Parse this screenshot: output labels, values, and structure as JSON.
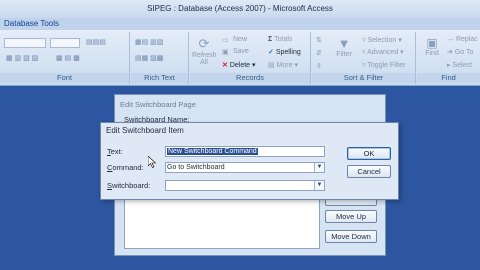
{
  "window": {
    "title": "SIPEG : Database (Access 2007) - Microsoft Access"
  },
  "tabs": {
    "database_tools": "Database Tools"
  },
  "ribbon": {
    "font_group": "Font",
    "rich_text_group": "Rich Text",
    "records_group": {
      "label": "Records",
      "refresh_all": "Refresh All",
      "new": "New",
      "save": "Save",
      "delete": "Delete",
      "totals": "Totals",
      "spelling": "Spelling",
      "more": "More"
    },
    "sort_filter_group": {
      "label": "Sort & Filter",
      "filter": "Filter",
      "selection": "Selection",
      "advanced": "Advanced",
      "toggle_filter": "Toggle Filter"
    },
    "find_group": {
      "label": "Find",
      "find": "Find",
      "replace": "Replac",
      "go_to": "Go To",
      "select": "Select"
    }
  },
  "switchboard_page": {
    "title": "Edit Switchboard Page",
    "name_label": "Switchboard Name:",
    "buttons": {
      "move_up": "Move Up",
      "move_down": "Move Down"
    }
  },
  "switchboard_item": {
    "title": "Edit Switchboard Item",
    "text_label": "Text:",
    "text_value": "New Switchboard Command",
    "command_label": "Command:",
    "command_value": "Go to Switchboard",
    "switchboard_label": "Switchboard:",
    "switchboard_value": "",
    "ok": "OK",
    "cancel": "Cancel"
  }
}
